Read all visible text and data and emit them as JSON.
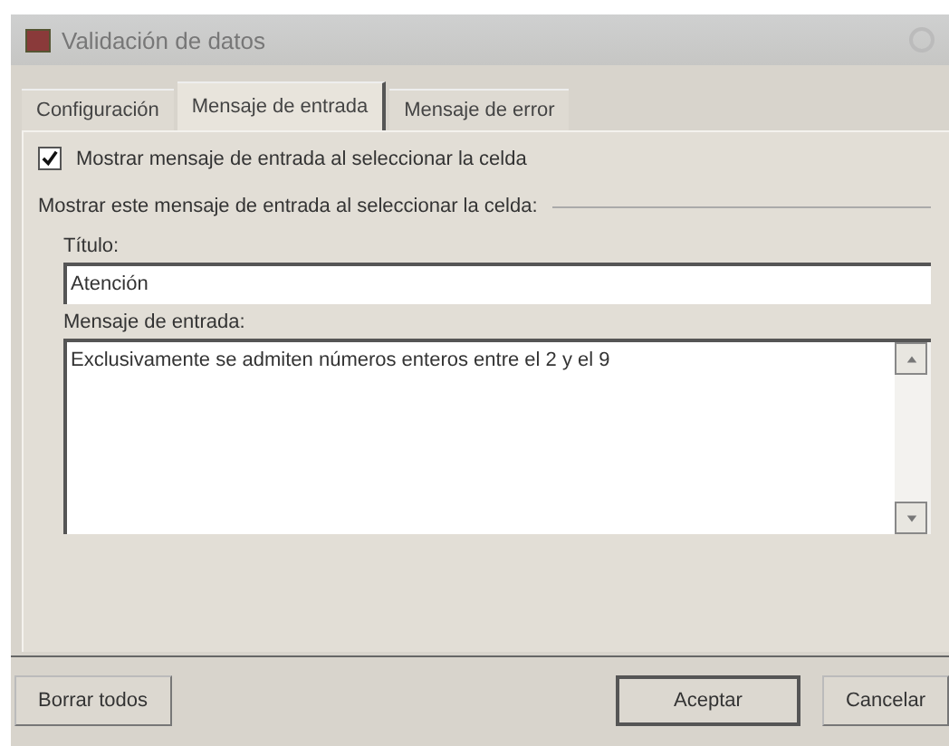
{
  "window": {
    "title": "Validación de datos"
  },
  "tabs": [
    {
      "label": "Configuración",
      "selected": false
    },
    {
      "label": "Mensaje de entrada",
      "selected": true
    },
    {
      "label": "Mensaje de error",
      "selected": false
    }
  ],
  "show_checkbox": {
    "label": "Mostrar mensaje de entrada al seleccionar la celda",
    "checked": true
  },
  "group_label": "Mostrar este mensaje de entrada al seleccionar la celda:",
  "title_field": {
    "label": "Título:",
    "value": "Atención"
  },
  "message_field": {
    "label": "Mensaje de entrada:",
    "value": "Exclusivamente se admiten números enteros entre el 2 y el 9"
  },
  "buttons": [
    {
      "label": "Borrar todos",
      "kind": "left"
    },
    {
      "label": "Aceptar",
      "kind": "default"
    },
    {
      "label": "Cancelar",
      "kind": "normal"
    }
  ]
}
